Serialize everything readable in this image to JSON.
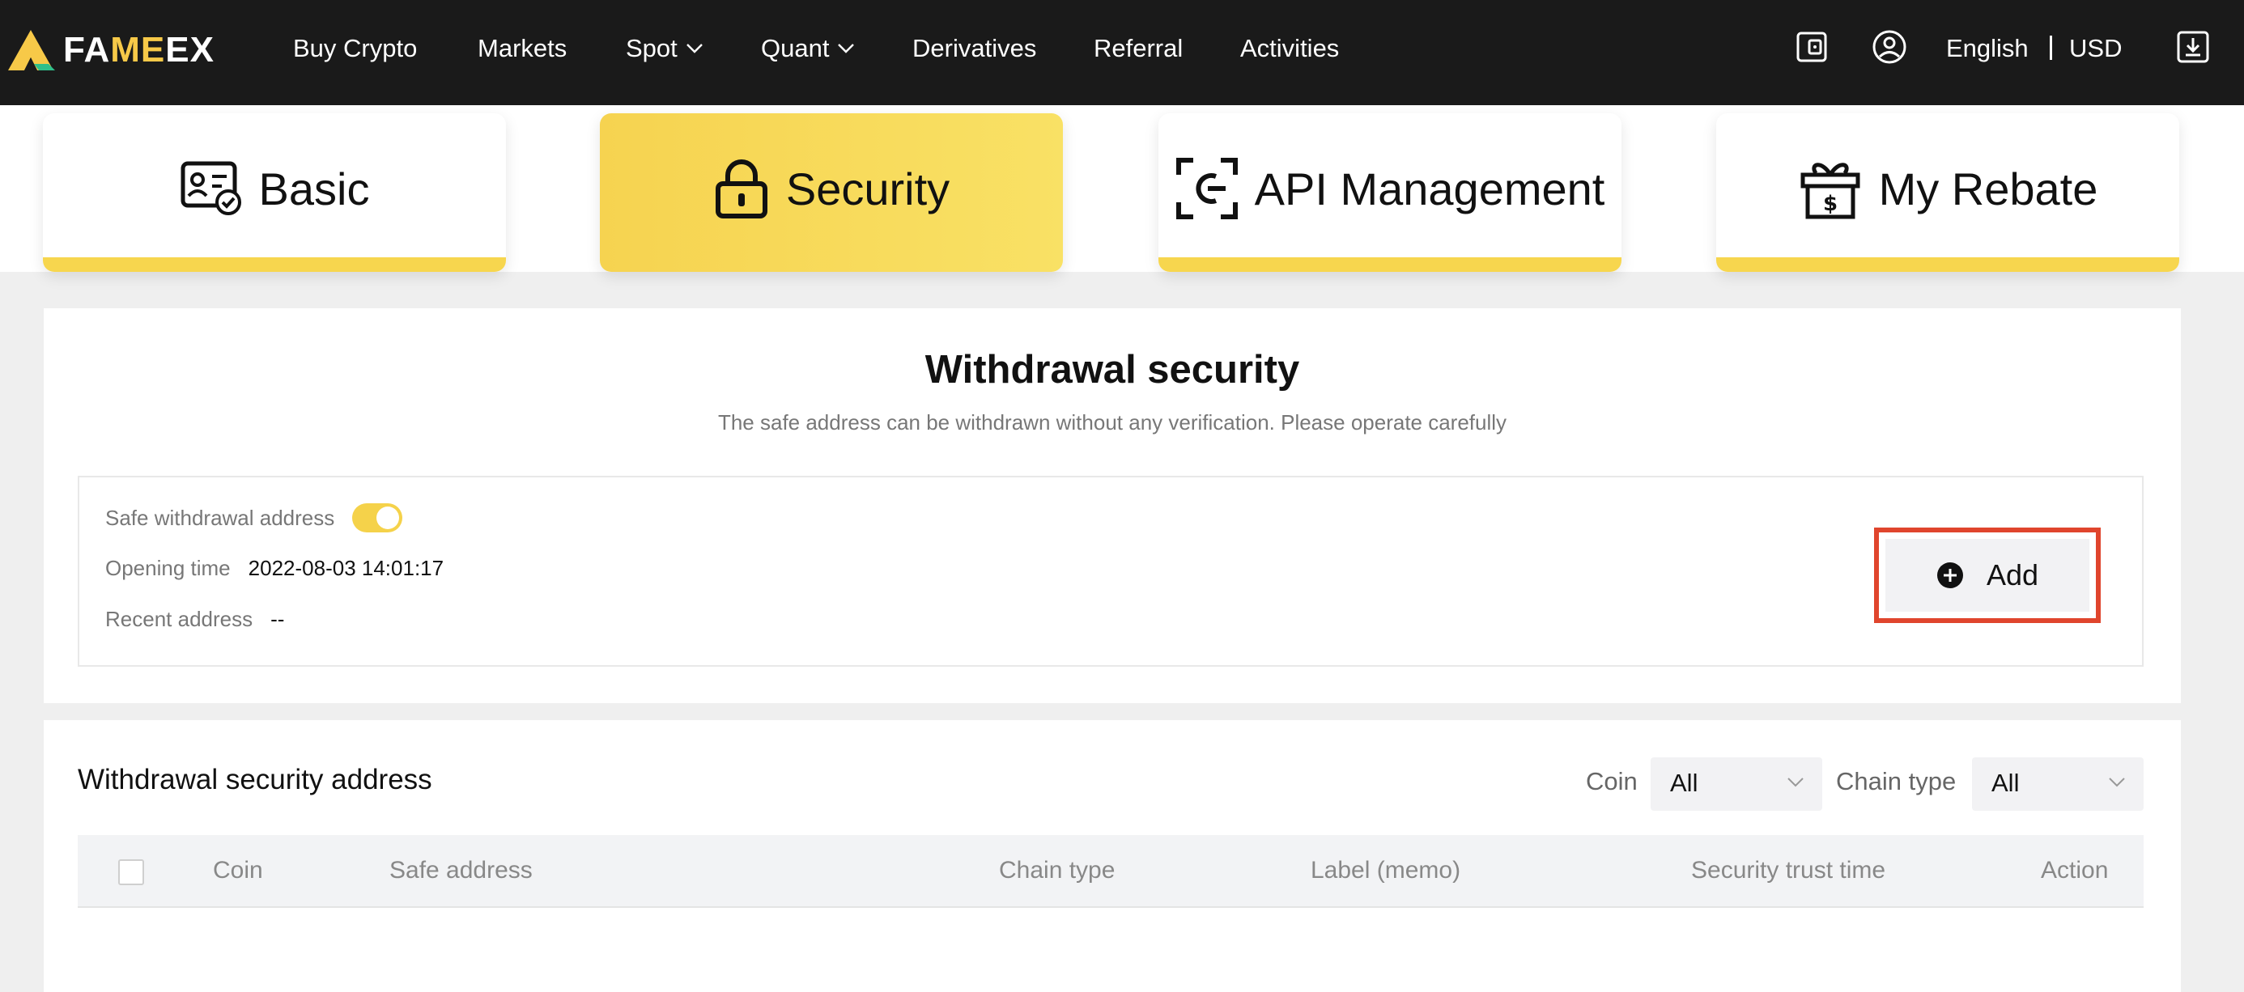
{
  "nav": {
    "logo": {
      "prefix": "FA",
      "accent": "ME",
      "suffix": "EX"
    },
    "items": [
      {
        "label": "Buy Crypto"
      },
      {
        "label": "Markets"
      },
      {
        "label": "Spot"
      },
      {
        "label": "Quant"
      },
      {
        "label": "Derivatives"
      },
      {
        "label": "Referral"
      },
      {
        "label": "Activities"
      }
    ],
    "language": "English",
    "currency": "USD",
    "icons": [
      "wallet-icon",
      "user-icon",
      "download-icon"
    ]
  },
  "tabs": [
    {
      "label": "Basic",
      "icon": "id-card-icon",
      "active": false
    },
    {
      "label": "Security",
      "icon": "lock-icon",
      "active": true
    },
    {
      "label": "API Management",
      "icon": "api-icon",
      "active": false
    },
    {
      "label": "My Rebate",
      "icon": "gift-icon",
      "active": false
    }
  ],
  "withdrawal_security": {
    "title": "Withdrawal security",
    "subtitle": "The safe address can be withdrawn without any verification. Please operate carefully",
    "safe_address_label": "Safe withdrawal address",
    "safe_address_enabled": true,
    "opening_time_label": "Opening time",
    "opening_time_value": "2022-08-03 14:01:17",
    "recent_address_label": "Recent address",
    "recent_address_value": "--",
    "add_label": "Add"
  },
  "address_list": {
    "title": "Withdrawal security address",
    "filters": [
      {
        "label": "Coin",
        "value": "All"
      },
      {
        "label": "Chain type",
        "value": "All"
      }
    ],
    "columns": [
      "Coin",
      "Safe address",
      "Chain type",
      "Label (memo)",
      "Security trust time",
      "Action"
    ]
  },
  "colors": {
    "nav_bg": "#1a1a1a",
    "accent_yellow": "#f7d64e",
    "highlight_red": "#e0452d"
  }
}
